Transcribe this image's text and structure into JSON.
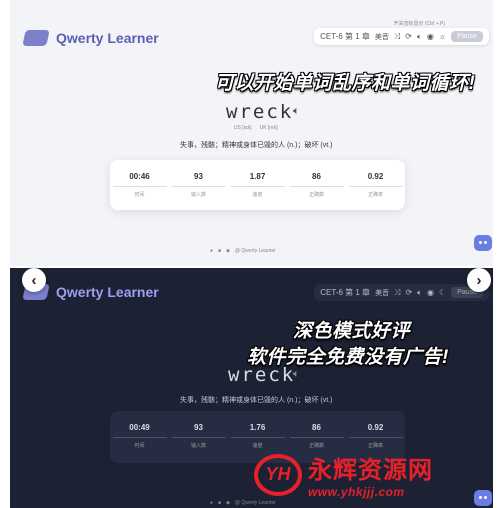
{
  "light": {
    "app_name": "Qwerty Learner",
    "hint": "开关音标显示 (Ctrl + P)",
    "dict": "CET-6 第 1 章",
    "accent": "美音",
    "pause": "Pause",
    "promo": "可以开始单词乱序和单词循环!",
    "word": "wreck",
    "phonetic_us": "US [rɛk]",
    "phonetic_uk": "UK [rek]",
    "translation": "失事，残骸；精神或身体已毁的人 (n.)；破坏 (vt.)",
    "stats": [
      {
        "value": "00:46",
        "label": "时间"
      },
      {
        "value": "93",
        "label": "输入数"
      },
      {
        "value": "1.87",
        "label": "速度"
      },
      {
        "value": "86",
        "label": "正确数"
      },
      {
        "value": "0.92",
        "label": "正确率"
      }
    ],
    "footer": "@ Qwerty Learner"
  },
  "dark": {
    "app_name": "Qwerty Learner",
    "dict": "CET-6 第 1 章",
    "accent": "美音",
    "pause": "Pause",
    "promo_line1": "深色模式好评",
    "promo_line2": "软件完全免费没有广告!",
    "word": "wreck",
    "translation": "失事，残骸；精神或身体已毁的人 (n.)；破坏 (vt.)",
    "stats": [
      {
        "value": "00:49",
        "label": "时间"
      },
      {
        "value": "93",
        "label": "输入数"
      },
      {
        "value": "1.76",
        "label": "速度"
      },
      {
        "value": "86",
        "label": "正确数"
      },
      {
        "value": "0.92",
        "label": "正确率"
      }
    ],
    "footer": "@ Qwerty Learner"
  },
  "nav": {
    "prev": "‹",
    "next": "›"
  },
  "watermark": {
    "logo": "YH",
    "title": "永辉资源网",
    "url": "www.yhkjjj.com"
  },
  "colors": {
    "accent": "#6a7de0",
    "watermark": "#e8202a"
  },
  "icons": [
    "sound-icon",
    "shuffle-icon",
    "loop-icon",
    "eye-icon",
    "theme-icon"
  ]
}
